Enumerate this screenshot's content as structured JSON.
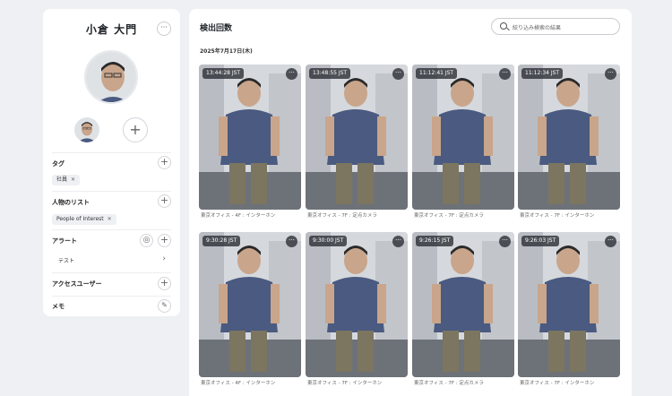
{
  "profile": {
    "name": "小倉 大門",
    "more_icon": "···",
    "add_icon": "+"
  },
  "sections": {
    "tags": {
      "title": "タグ",
      "chips": [
        "社員"
      ]
    },
    "lists": {
      "title": "人物のリスト",
      "chips": [
        "People of Interest"
      ]
    },
    "alerts": {
      "title": "アラート",
      "items": [
        "テスト"
      ]
    },
    "access_users": {
      "title": "アクセスユーザー"
    },
    "memo": {
      "title": "メモ"
    }
  },
  "main": {
    "title": "検出回数",
    "search_placeholder": "絞り込み検索の結果",
    "date": "2025年7月17日(木)",
    "detections": [
      {
        "time": "13:44:28 JST",
        "location": "東京オフィス - 4F : インターホン"
      },
      {
        "time": "13:48:55 JST",
        "location": "東京オフィス - 7F : 定点カメラ"
      },
      {
        "time": "11:12:41 JST",
        "location": "東京オフィス - 7F : 定点カメラ"
      },
      {
        "time": "11:12:34 JST",
        "location": "東京オフィス - 7F : インターホン"
      },
      {
        "time": "9:30:28 JST",
        "location": "東京オフィス - 4F : インターホン"
      },
      {
        "time": "9:30:00 JST",
        "location": "東京オフィス - 7F : インターホン"
      },
      {
        "time": "9:26:15 JST",
        "location": "東京オフィス - 7F : 定点カメラ"
      },
      {
        "time": "9:26:03 JST",
        "location": "東京オフィス - 7F : インターホン"
      }
    ]
  },
  "colors": {
    "page_bg": "#eef0f3",
    "panel_bg": "#ffffff",
    "shirt": "#4a5a80",
    "timestamp_bg": "#2c3036"
  }
}
